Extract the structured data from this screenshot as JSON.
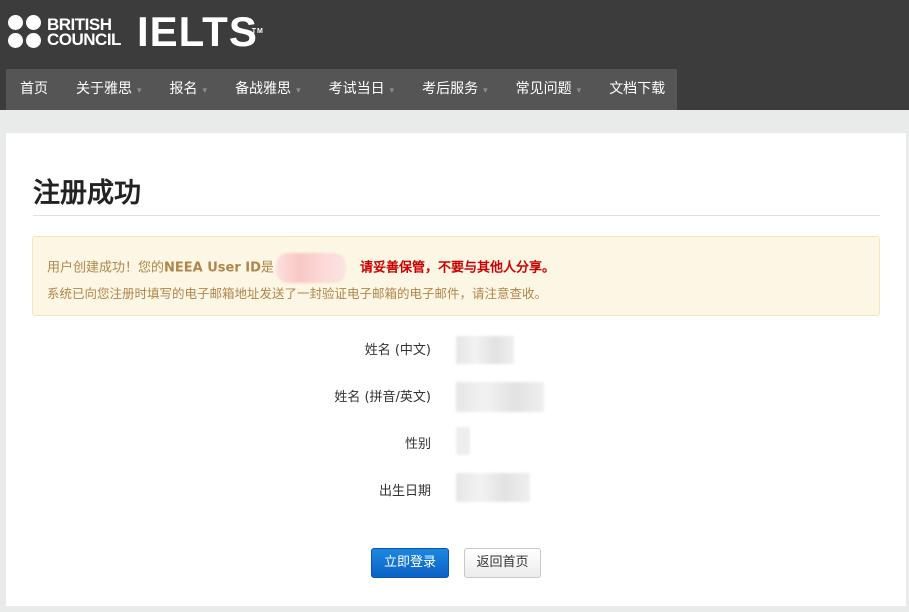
{
  "header": {
    "brand_line1": "BRITISH",
    "brand_line2": "COUNCIL",
    "logo_text": "IELTS",
    "logo_mark": "TM"
  },
  "nav": {
    "items": [
      {
        "label": "首页",
        "has_dropdown": false
      },
      {
        "label": "关于雅思",
        "has_dropdown": true
      },
      {
        "label": "报名",
        "has_dropdown": true
      },
      {
        "label": "备战雅思",
        "has_dropdown": true
      },
      {
        "label": "考试当日",
        "has_dropdown": true
      },
      {
        "label": "考后服务",
        "has_dropdown": true
      },
      {
        "label": "常见问题",
        "has_dropdown": true
      },
      {
        "label": "文档下载",
        "has_dropdown": false
      }
    ],
    "caret": "▾"
  },
  "main": {
    "title": "注册成功",
    "alert": {
      "line1_prefix": "用户创建成功！您的",
      "line1_bold": "NEEA User ID",
      "line1_suffix": "是",
      "warning": "请妥善保管，不要与其他人分享。",
      "line2": "系统已向您注册时填写的电子邮箱地址发送了一封验证电子邮箱的电子邮件，请注意查收。"
    },
    "fields": [
      {
        "label": "姓名 (中文)"
      },
      {
        "label": "姓名 (拼音/英文)"
      },
      {
        "label": "性别"
      },
      {
        "label": "出生日期"
      }
    ],
    "buttons": {
      "login": "立即登录",
      "home": "返回首页"
    }
  },
  "colors": {
    "header_bg": "#3c3c3c",
    "nav_bg": "#555555",
    "alert_bg": "#fcf7e5",
    "warning_text": "#cc0000",
    "primary_button": "#0b62c5"
  }
}
